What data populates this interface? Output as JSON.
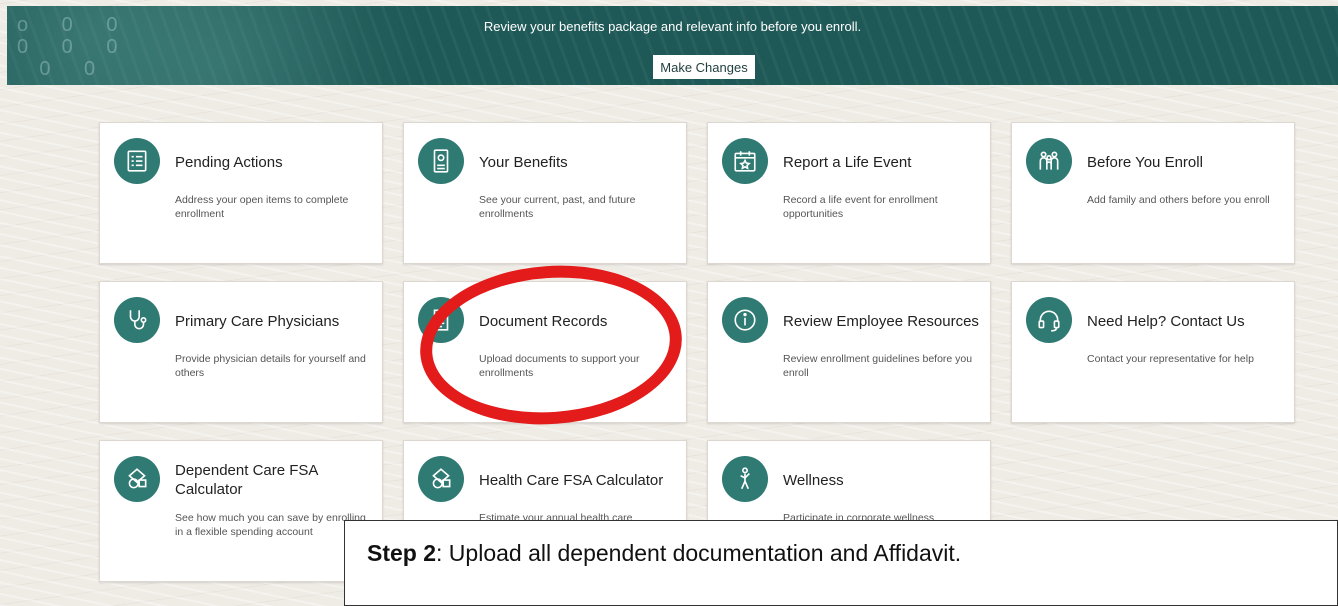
{
  "banner": {
    "message": "Review your benefits package and relevant info before you enroll.",
    "button_label": "Make Changes"
  },
  "cards": [
    {
      "title": "Pending Actions",
      "desc": "Address your open items to complete enrollment",
      "icon": "checklist-icon"
    },
    {
      "title": "Your Benefits",
      "desc": "See your current, past, and future enrollments",
      "icon": "benefits-card-icon"
    },
    {
      "title": "Report a Life Event",
      "desc": "Record a life event for enrollment opportunities",
      "icon": "calendar-star-icon"
    },
    {
      "title": "Before You Enroll",
      "desc": "Add family and others before you enroll",
      "icon": "family-icon"
    },
    {
      "title": "Primary Care Physicians",
      "desc": "Provide physician details for yourself and others",
      "icon": "stethoscope-icon"
    },
    {
      "title": "Document Records",
      "desc": "Upload documents to support your enrollments",
      "icon": "document-icon"
    },
    {
      "title": "Review Employee Resources",
      "desc": "Review enrollment guidelines before you enroll",
      "icon": "info-icon"
    },
    {
      "title": "Need Help? Contact Us",
      "desc": "Contact your representative for help",
      "icon": "headset-icon"
    },
    {
      "title": "Dependent Care FSA Calculator",
      "desc": "See how much you can save by enrolling in a flexible spending account",
      "icon": "calculator-shapes-icon"
    },
    {
      "title": "Health Care FSA Calculator",
      "desc": "Estimate your annual health care",
      "icon": "calculator-shapes-icon"
    },
    {
      "title": "Wellness",
      "desc": "Participate in corporate wellness",
      "icon": "wellness-figure-icon"
    }
  ],
  "annotation": {
    "step_label": "Step 2",
    "step_text": ":  Upload all dependent documentation and Affidavit."
  },
  "colors": {
    "accent": "#1f5957",
    "icon_bg": "#2f7a72",
    "highlight": "#e31b1b"
  }
}
